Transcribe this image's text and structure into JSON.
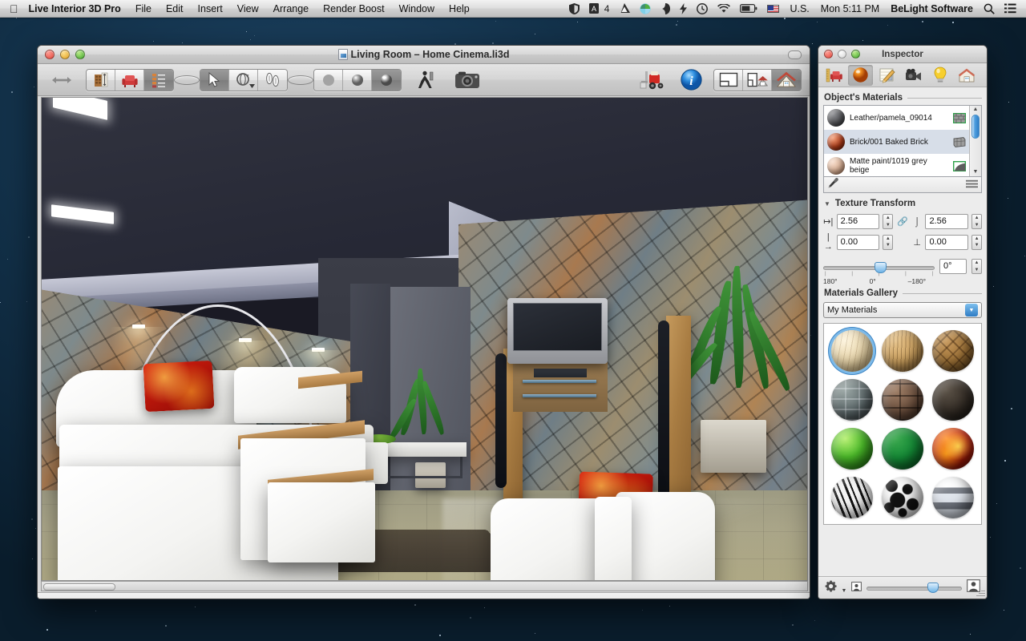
{
  "menubar": {
    "apple_icon": "apple-icon",
    "app_name": "Live Interior 3D Pro",
    "items": [
      "File",
      "Edit",
      "Insert",
      "View",
      "Arrange",
      "Render Boost",
      "Window",
      "Help"
    ],
    "status_icons": [
      "shield-icon",
      "adobe-icon",
      "drive-icon",
      "dropbox-icon",
      "evernote-icon",
      "flash-icon",
      "timemachine-icon",
      "wifi-icon",
      "battery-icon"
    ],
    "adobe_badge": "4",
    "input_source": "U.S.",
    "clock": "Mon 5:11 PM",
    "user": "BeLight Software",
    "search_icon": "search-icon",
    "notification_icon": "notification-center-icon"
  },
  "window": {
    "title": "Living Room – Home Cinema.li3d",
    "close_label": "close",
    "minimize_label": "minimize",
    "zoom_label": "zoom",
    "toolbar": {
      "resize_icon": "horizontal-resize-icon",
      "building_icon": "building-tool-icon",
      "furniture_icon": "furniture-tool-icon",
      "list_icon": "project-tree-icon",
      "select_icon": "select-arrow-icon",
      "orbit_icon": "orbit-rotate-icon",
      "walk_icon": "walk-tool-icon",
      "shading_flat_icon": "shading-flat-icon",
      "shading_shaded_icon": "shading-shaded-icon",
      "shading_glossy_icon": "shading-glossy-icon",
      "person_icon": "walkthrough-person-icon",
      "camera_icon": "camera-icon",
      "render_boost_icon": "render-boost-forklift-icon",
      "info_icon": "info-icon",
      "view_plan_icon": "view-2d-plan-icon",
      "view_split_icon": "view-split-icon",
      "view_3d_icon": "view-3d-icon"
    },
    "statusbar": {
      "grip": "resize-grip"
    }
  },
  "inspector": {
    "title": "Inspector",
    "tabs": [
      {
        "name": "tab-object",
        "icon": "furniture-ruler-icon",
        "selected": false
      },
      {
        "name": "tab-materials",
        "icon": "material-sphere-icon",
        "selected": true
      },
      {
        "name": "tab-edit",
        "icon": "pencil-edit-icon",
        "selected": false
      },
      {
        "name": "tab-camera",
        "icon": "video-camera-icon",
        "selected": false
      },
      {
        "name": "tab-light",
        "icon": "light-bulb-icon",
        "selected": false
      },
      {
        "name": "tab-house",
        "icon": "house-icon",
        "selected": false
      }
    ],
    "object_materials": {
      "header": "Object's Materials",
      "rows": [
        {
          "name": "Leather/pamela_09014",
          "color": "#55565a",
          "badge": "brick-texture-badge",
          "selected": false
        },
        {
          "name": "Brick/001 Baked Brick",
          "color": "#b03c19",
          "badge": "brick-texture-badge",
          "selected": true
        },
        {
          "name": "Matte paint/1019 grey beige",
          "color": "#ddb397",
          "badge": "paint-swatch-badge",
          "selected": false
        }
      ],
      "eyedropper_icon": "eyedropper-icon",
      "menu_icon": "list-menu-icon",
      "scrollbar": "vertical-scrollbar"
    },
    "texture_transform": {
      "header": "Texture Transform",
      "disclosure": "▼",
      "width_icon": "width-icon",
      "width_value": "2.56",
      "link_icon": "link-chain-icon",
      "height_icon": "height-icon",
      "height_value": "2.56",
      "offset_x_icon": "offset-x-icon",
      "offset_x_value": "0.00",
      "offset_y_icon": "offset-y-icon",
      "offset_y_value": "0.00",
      "rotation_value": "0°",
      "slider_left_label": "180°",
      "slider_center_label": "0°",
      "slider_right_label": "–180°"
    },
    "materials_gallery": {
      "header": "Materials Gallery",
      "selected_collection": "My Materials",
      "dropdown_icon": "chevron-down-icon",
      "swatches": [
        {
          "name": "light-wood",
          "selected": true
        },
        {
          "name": "oak-wood",
          "selected": false
        },
        {
          "name": "parquet-wood",
          "selected": false
        },
        {
          "name": "grey-stone",
          "selected": false
        },
        {
          "name": "dark-brick",
          "selected": false
        },
        {
          "name": "dark-asphalt",
          "selected": false
        },
        {
          "name": "bright-green",
          "selected": false
        },
        {
          "name": "dark-green",
          "selected": false
        },
        {
          "name": "fire-lava",
          "selected": false
        },
        {
          "name": "zebra-print",
          "selected": false
        },
        {
          "name": "cow-print",
          "selected": false
        },
        {
          "name": "chrome-metal",
          "selected": false
        }
      ]
    },
    "footer": {
      "gear_icon": "gear-settings-icon",
      "small_icon": "small-thumbnail-icon",
      "large_icon": "large-thumbnail-icon",
      "slider_position": "64"
    }
  },
  "scene": {
    "description": "3D rendered living room with home cinema",
    "items": [
      "ceiling-soffit",
      "stone-wall",
      "arc-floor-lamp",
      "flat-screen-tv",
      "tower-speakers",
      "white-sectional-sofa",
      "red-cushions",
      "armchair",
      "coffee-table",
      "potted-plants",
      "area-rug",
      "glossy-floor"
    ]
  }
}
